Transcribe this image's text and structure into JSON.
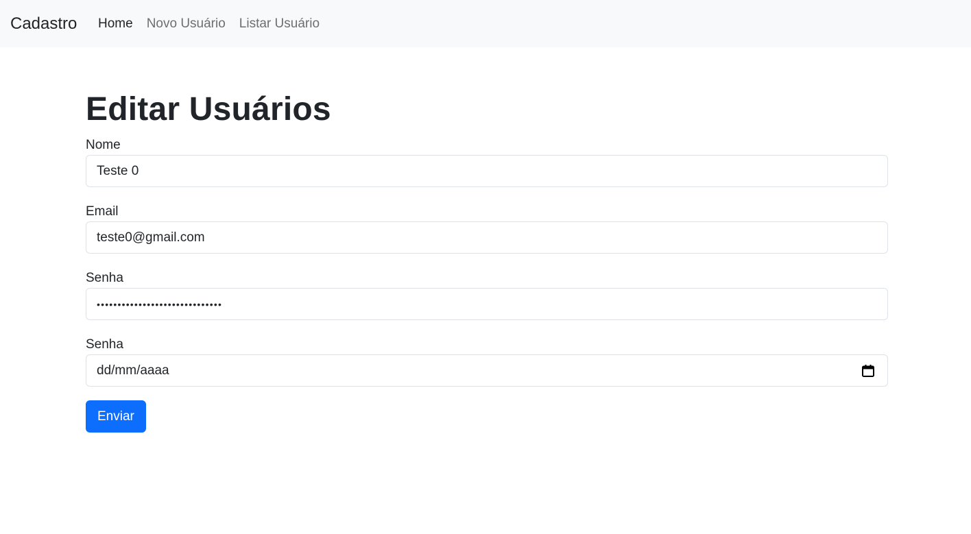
{
  "navbar": {
    "brand": "Cadastro",
    "links": [
      {
        "label": "Home",
        "active": true
      },
      {
        "label": "Novo Usuário",
        "active": false
      },
      {
        "label": "Listar Usuário",
        "active": false
      }
    ]
  },
  "page": {
    "title": "Editar Usuários"
  },
  "form": {
    "nome": {
      "label": "Nome",
      "value": "Teste 0"
    },
    "email": {
      "label": "Email",
      "value": "teste0@gmail.com"
    },
    "senha": {
      "label": "Senha",
      "value": "••••••••••••••••••••••••••••••"
    },
    "data": {
      "label": "Senha",
      "placeholder": "dd/mm/aaaa",
      "icon": "calendar-icon"
    },
    "submit_label": "Enviar"
  },
  "colors": {
    "navbar_bg": "#f8f9fa",
    "primary": "#0d6efd",
    "text": "#212529",
    "muted_link": "#6c6f72"
  }
}
